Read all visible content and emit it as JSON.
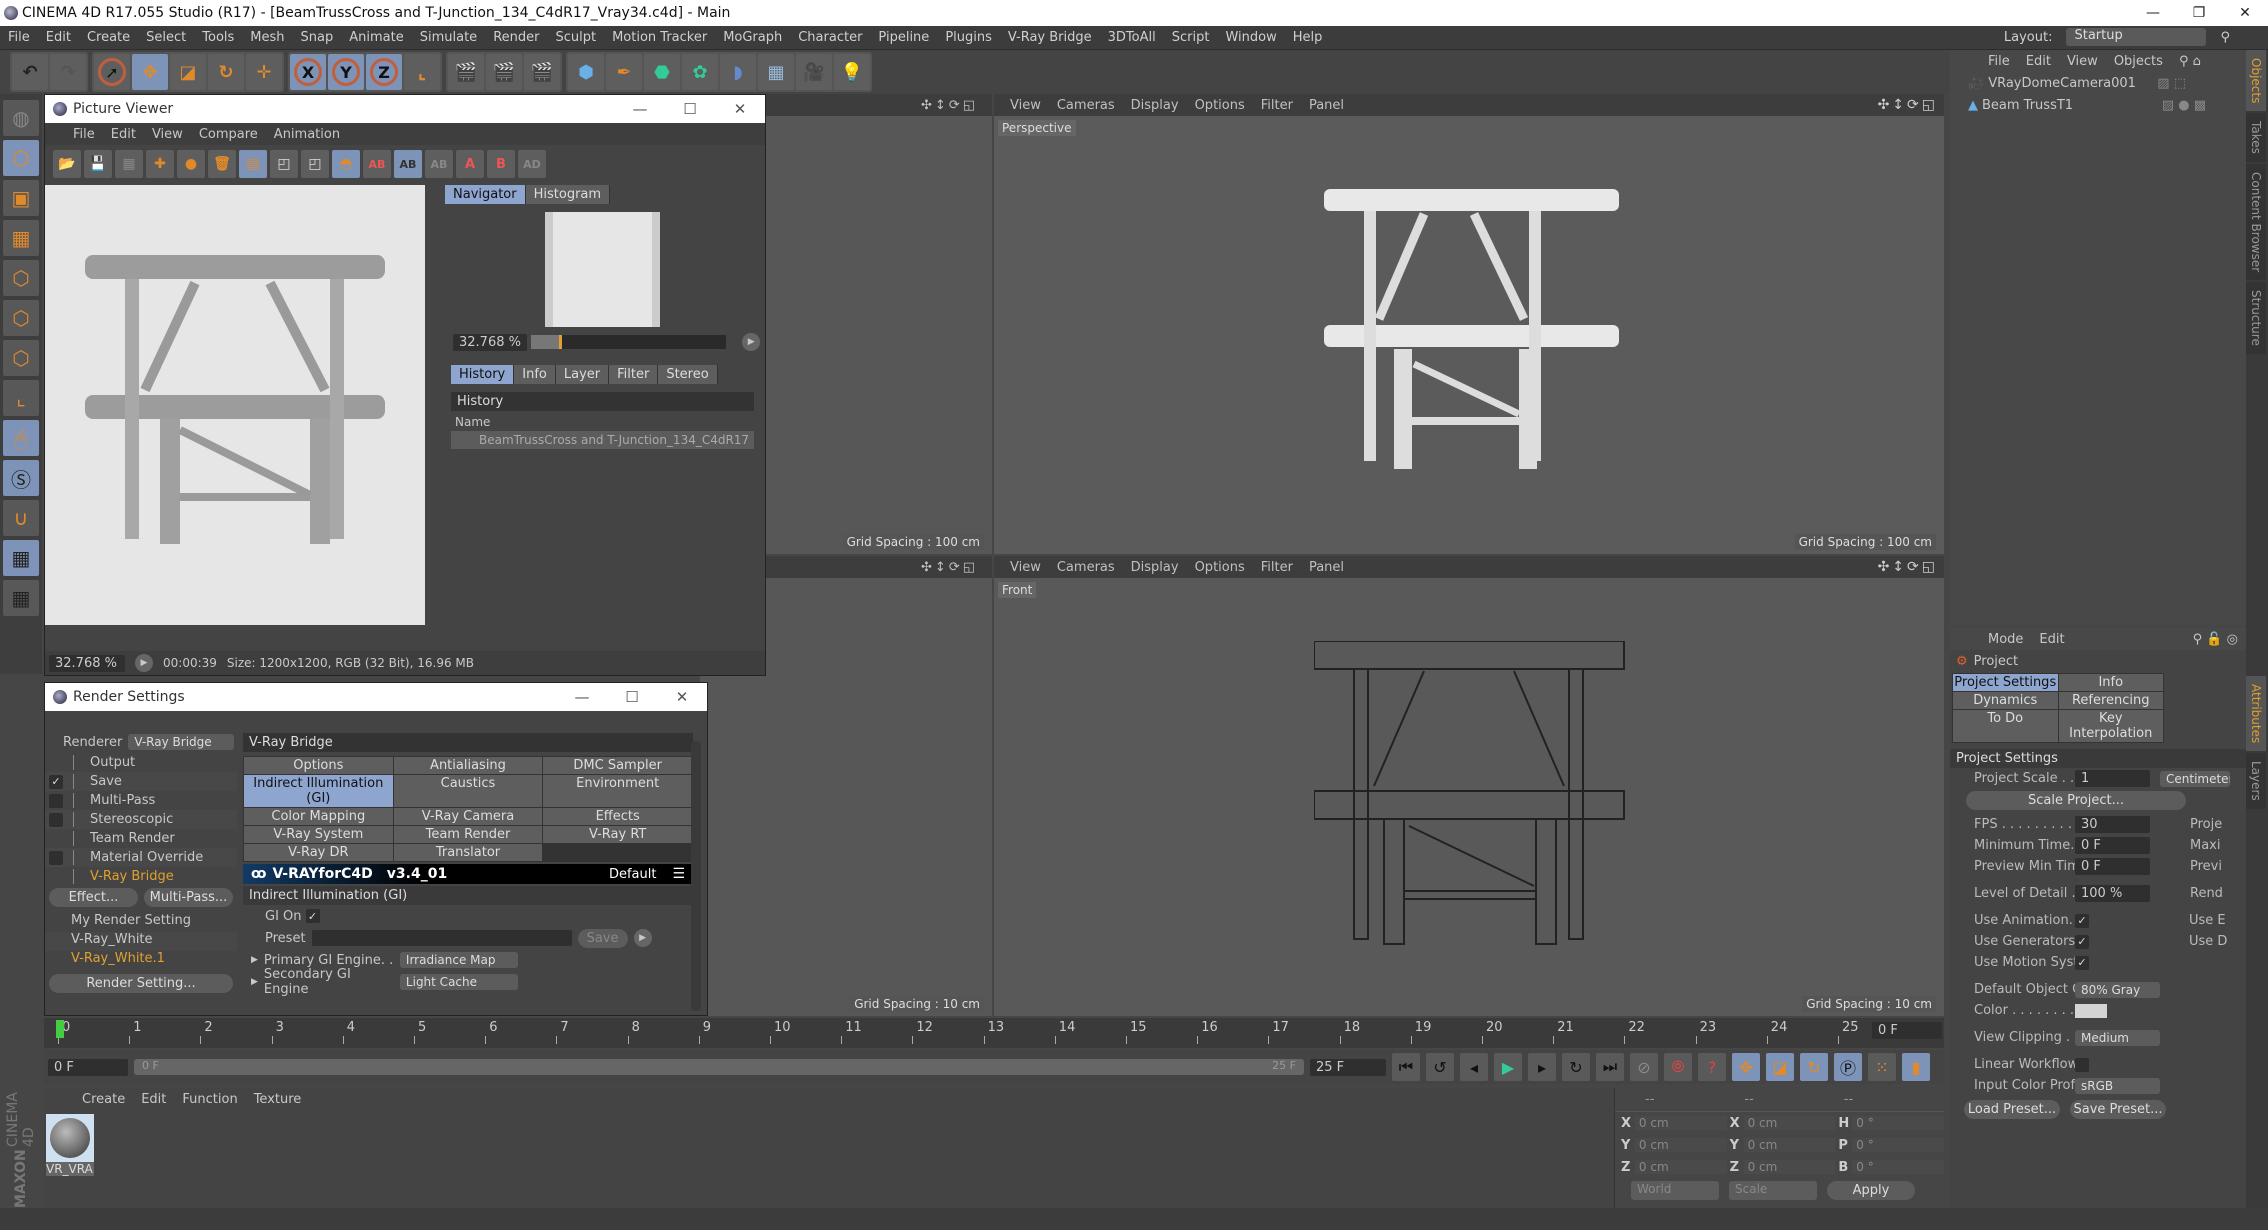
{
  "app": {
    "title": "CINEMA 4D R17.055 Studio (R17) - [BeamTrussCross and T-Junction_134_C4dR17_Vray34.c4d] - Main",
    "window_controls": [
      "—",
      "❐",
      "✕"
    ],
    "layout_label": "Layout:",
    "layout_value": "Startup"
  },
  "menu": [
    "File",
    "Edit",
    "Create",
    "Select",
    "Tools",
    "Mesh",
    "Snap",
    "Animate",
    "Simulate",
    "Render",
    "Sculpt",
    "Motion Tracker",
    "MoGraph",
    "Character",
    "Pipeline",
    "Plugins",
    "V-Ray Bridge",
    "3DToAll",
    "Script",
    "Window",
    "Help"
  ],
  "toolbar": {
    "axes": [
      "X",
      "Y",
      "Z"
    ]
  },
  "viewports": {
    "menu": [
      "View",
      "Cameras",
      "Display",
      "Options",
      "Filter",
      "Panel"
    ],
    "perspective": {
      "label": "Perspective",
      "grid": "Grid Spacing : 100 cm"
    },
    "top_left": {
      "grid": "Grid Spacing : 100 cm"
    },
    "front": {
      "label": "Front",
      "grid": "Grid Spacing : 10 cm"
    },
    "bottom_left": {
      "grid": "Grid Spacing : 10 cm"
    }
  },
  "picture_viewer": {
    "title": "Picture Viewer",
    "menu": [
      "File",
      "Edit",
      "View",
      "Compare",
      "Animation"
    ],
    "nav_tabs": [
      "Navigator",
      "Histogram"
    ],
    "zoom": "32.768 %",
    "info_tabs": [
      "History",
      "Info",
      "Layer",
      "Filter",
      "Stereo"
    ],
    "history_header": "History",
    "name_col": "Name",
    "history_item": "BeamTrussCross and T-Junction_134_C4dR17",
    "status_zoom": "32.768 %",
    "status_time": "00:00:39",
    "status_size": "Size: 1200x1200, RGB (32 Bit), 16.96 MB"
  },
  "render_settings": {
    "title": "Render Settings",
    "renderer_label": "Renderer",
    "renderer_value": "V-Ray Bridge",
    "tree": [
      {
        "label": "Output",
        "check": "none"
      },
      {
        "label": "Save",
        "check": "on"
      },
      {
        "label": "Multi-Pass",
        "check": "off"
      },
      {
        "label": "Stereoscopic",
        "check": "off"
      },
      {
        "label": "Team Render",
        "check": "none"
      },
      {
        "label": "Material Override",
        "check": "off"
      },
      {
        "label": "V-Ray Bridge",
        "check": "none",
        "active": true
      }
    ],
    "effect_btn": "Effect...",
    "multipass_btn": "Multi-Pass...",
    "presets": [
      "My Render Setting",
      "V-Ray_White",
      "V-Ray_White.1"
    ],
    "render_setting_btn": "Render Setting...",
    "section": "V-Ray Bridge",
    "tabs": [
      "Options",
      "Antialiasing",
      "DMC Sampler",
      "Indirect Illumination (GI)",
      "Caustics",
      "Environment",
      "Color Mapping",
      "V-Ray Camera",
      "Effects",
      "V-Ray System",
      "Team Render",
      "V-Ray RT",
      "V-Ray DR",
      "Translator"
    ],
    "active_tab": "Indirect Illumination (GI)",
    "banner_brand": "V-RAYforC4D",
    "banner_version": "v3.4_01",
    "banner_preset": "Default",
    "gi_section": "Indirect Illumination (GI)",
    "gi_on_label": "GI On",
    "preset_label": "Preset",
    "save_btn": "Save",
    "primary_label": "Primary GI Engine. .",
    "primary_value": "Irradiance Map",
    "secondary_label": "Secondary GI Engine",
    "secondary_value": "Light Cache"
  },
  "objects": {
    "menu": [
      "File",
      "Edit",
      "View",
      "Objects"
    ],
    "items": [
      "VRayDomeCamera001",
      "Beam TrussT1"
    ]
  },
  "attributes": {
    "menu": [
      "Mode",
      "Edit"
    ],
    "title": "Project",
    "tabs": [
      "Project Settings",
      "Info",
      "Dynamics",
      "Referencing",
      "To Do",
      "Key Interpolation"
    ],
    "section": "Project Settings",
    "project_scale_label": "Project Scale . . . . . . .",
    "project_scale": "1",
    "unit": "Centimeters",
    "scale_btn": "Scale Project...",
    "fps_label": "FPS . . . . . . . . . . . . . . .",
    "fps": "30",
    "min_time_label": "Minimum Time. . . . .",
    "min_time": "0 F",
    "prev_min_label": "Preview Min Time . .",
    "prev_min": "0 F",
    "right_cut": [
      "Proje",
      "Maxi",
      "Previ"
    ],
    "lod_label": "Level of Detail . . . . .",
    "lod": "100 %",
    "lod_right": "Rend",
    "use_animation": "Use Animation. . . . .",
    "use_generators": "Use Generators . . . .",
    "use_motion": "Use Motion System",
    "use_right": [
      "Use E",
      "Use D"
    ],
    "doc_label": "Default Object Color",
    "doc_value": "80% Gray",
    "color_label": "Color . . . . . . . . . . .",
    "color_swatch": "#d4d4d4",
    "clip_label": "View Clipping . . . . .",
    "clip_value": "Medium",
    "linear_label": "Linear Workflow . . .",
    "profile_label": "Input Color Profile .",
    "profile_value": "sRGB",
    "load_btn": "Load Preset...",
    "save_btn": "Save Preset..."
  },
  "side_tabs_top": [
    "Objects",
    "Takes",
    "Content Browser",
    "Structure"
  ],
  "side_tabs_bottom": [
    "Attributes",
    "Layers"
  ],
  "timeline": {
    "frames": [
      "0",
      "1",
      "2",
      "3",
      "4",
      "5",
      "6",
      "7",
      "8",
      "9",
      "10",
      "11",
      "12",
      "13",
      "14",
      "15",
      "16",
      "17",
      "18",
      "19",
      "20",
      "21",
      "22",
      "23",
      "24",
      "25"
    ],
    "current": "0 F",
    "start": "0 F",
    "range_start": "0 F",
    "range_end": "25 F",
    "end": "25 F"
  },
  "materials": {
    "menu": [
      "Create",
      "Edit",
      "Function",
      "Texture"
    ],
    "items": [
      "VR_VRA"
    ]
  },
  "coords": {
    "headers": [
      "--",
      "--",
      "--"
    ],
    "rows": [
      [
        "X",
        "0 cm",
        "X",
        "0 cm",
        "H",
        "0 °"
      ],
      [
        "Y",
        "0 cm",
        "Y",
        "0 cm",
        "P",
        "0 °"
      ],
      [
        "Z",
        "0 cm",
        "Z",
        "0 cm",
        "B",
        "0 °"
      ]
    ],
    "mode1": "World",
    "mode2": "Scale",
    "apply": "Apply"
  },
  "brand": {
    "maxon": "MAXON",
    "c4d": "CINEMA 4D"
  }
}
